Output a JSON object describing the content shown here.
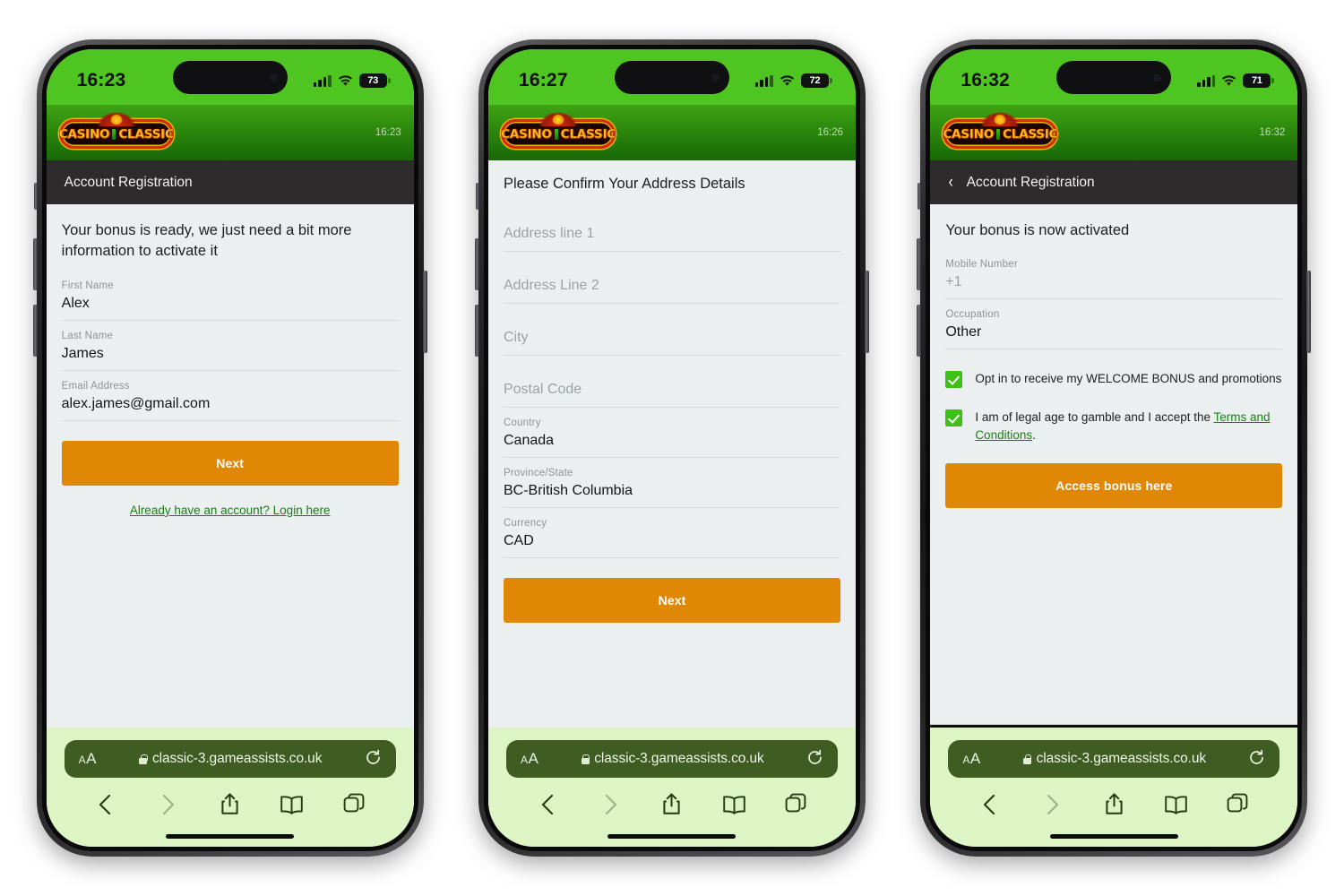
{
  "colors": {
    "accent_orange": "#e08806",
    "brand_green": "#3fa314",
    "status_green": "#4ec521",
    "link_green": "#1d7a1d",
    "checkbox_green": "#3fc016",
    "titlebar_dark": "#2d2b2b",
    "page_bg": "#eceff0",
    "safari_bg": "#ddf5c4",
    "url_pill": "#3f5c22"
  },
  "browser": {
    "url": "classic-3.gameassists.co.uk",
    "text_size_label_small": "A",
    "text_size_label_large": "A",
    "icons": [
      "back-icon",
      "forward-icon",
      "share-icon",
      "bookmarks-icon",
      "tabs-icon"
    ],
    "reload_icon": "reload-icon",
    "lock_icon": "lock-icon"
  },
  "brand": {
    "logo_word_1": "CASINO",
    "logo_word_2": "CLASSIC"
  },
  "phones": [
    {
      "status": {
        "time": "16:23",
        "battery": "73",
        "signal_icon": "cellular-signal-icon",
        "wifi_icon": "wifi-icon"
      },
      "header_time": "16:23",
      "titlebar": {
        "visible": true,
        "show_back": false,
        "title": "Account Registration"
      },
      "intro": "Your bonus is ready, we just need a bit more information to activate it",
      "fields": [
        {
          "label": "First Name",
          "value": "Alex",
          "placeholder": false
        },
        {
          "label": "Last Name",
          "value": "James",
          "placeholder": false
        },
        {
          "label": "Email Address",
          "value": "alex.james@gmail.com",
          "placeholder": false
        }
      ],
      "cta": "Next",
      "login_link": "Already have an account? Login here"
    },
    {
      "status": {
        "time": "16:27",
        "battery": "72",
        "signal_icon": "cellular-signal-icon",
        "wifi_icon": "wifi-icon"
      },
      "header_time": "16:26",
      "titlebar": {
        "visible": false,
        "show_back": false,
        "title": ""
      },
      "intro": "Please Confirm Your Address Details",
      "fields": [
        {
          "label": "",
          "value": "Address line 1",
          "placeholder": true
        },
        {
          "label": "",
          "value": "Address Line 2",
          "placeholder": true
        },
        {
          "label": "",
          "value": "City",
          "placeholder": true
        },
        {
          "label": "",
          "value": "Postal Code",
          "placeholder": true
        },
        {
          "label": "Country",
          "value": "Canada",
          "placeholder": false
        },
        {
          "label": "Province/State",
          "value": "BC-British Columbia",
          "placeholder": false
        },
        {
          "label": "Currency",
          "value": "CAD",
          "placeholder": false
        }
      ],
      "cta": "Next",
      "login_link": ""
    },
    {
      "status": {
        "time": "16:32",
        "battery": "71",
        "signal_icon": "cellular-signal-icon",
        "wifi_icon": "wifi-icon"
      },
      "header_time": "16:32",
      "titlebar": {
        "visible": true,
        "show_back": true,
        "title": "Account Registration"
      },
      "intro": "Your bonus is now activated",
      "fields": [
        {
          "label": "Mobile Number",
          "value": "+1",
          "placeholder": false,
          "dim": true
        },
        {
          "label": "Occupation",
          "value": "Other",
          "placeholder": false
        }
      ],
      "checkboxes": [
        {
          "checked": true,
          "text": "Opt in to receive my WELCOME BONUS and promotions",
          "link_text": "",
          "tail": ""
        },
        {
          "checked": true,
          "text": "I am of legal age to gamble and I accept the ",
          "link_text": "Terms and Conditions",
          "tail": "."
        }
      ],
      "cta": "Access bonus here",
      "login_link": ""
    }
  ]
}
